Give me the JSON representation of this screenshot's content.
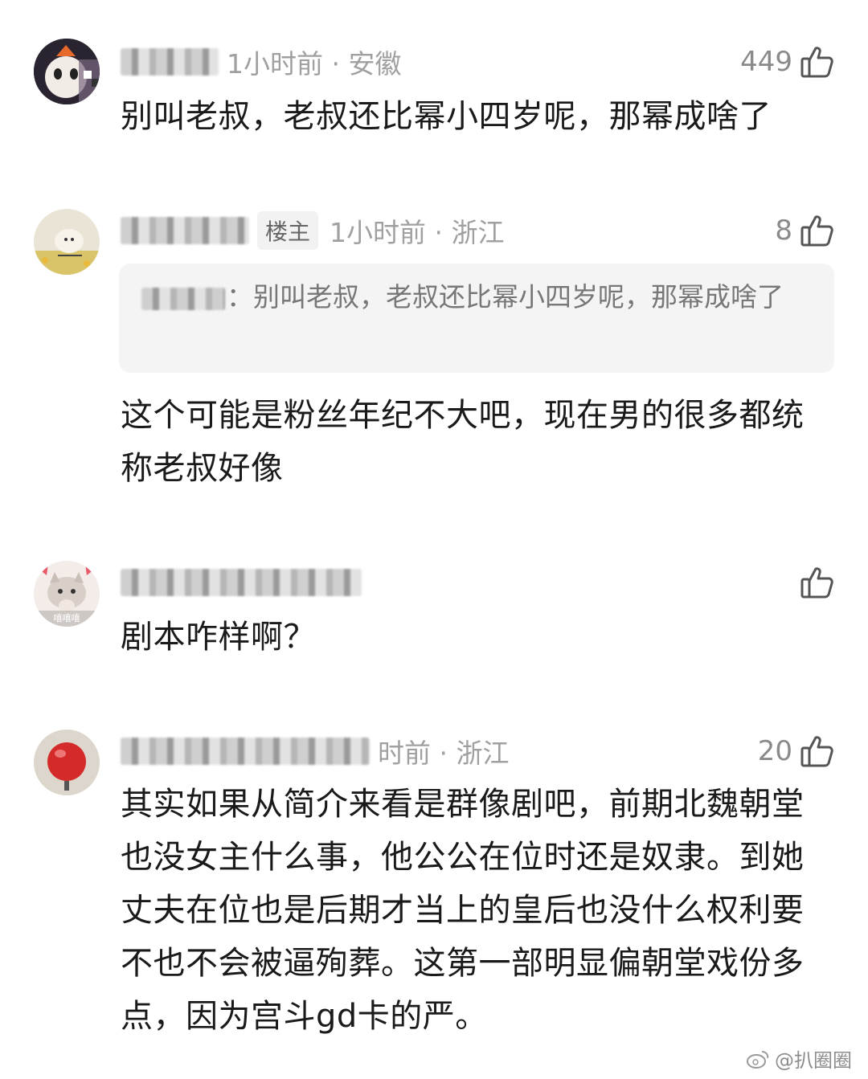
{
  "comments": [
    {
      "meta": "1小时前 · 安徽",
      "likes": "449",
      "text": "别叫老叔，老叔还比幂小四岁呢，那幂成啥了"
    },
    {
      "op_badge": "楼主",
      "meta": "1小时前 · 浙江",
      "likes": "8",
      "quote_text": "：别叫老叔，老叔还比幂小四岁呢，那幂成啥了",
      "text": "这个可能是粉丝年纪不大吧，现在男的很多都统称老叔好像"
    },
    {
      "meta": "",
      "likes": "",
      "text": "剧本咋样啊？"
    },
    {
      "meta": "时前 · 浙江",
      "likes": "20",
      "text": "其实如果从简介来看是群像剧吧，前期北魏朝堂也没女主什么事，他公公在位时还是奴隶。到她丈夫在位也是后期才当上的皇后也没什么权利要不也不会被逼殉葬。这第一部明显偏朝堂戏份多点，因为宫斗gd卡的严。"
    }
  ],
  "avatar_badge_3": "嘻嘻嘻",
  "watermark": "@扒圈圈",
  "colors": {
    "meta": "#a0a0a0",
    "text": "#1a1a1a",
    "quote_bg": "#f4f4f4"
  },
  "icons": [
    "thumbs-up-icon",
    "weibo-logo-icon"
  ]
}
